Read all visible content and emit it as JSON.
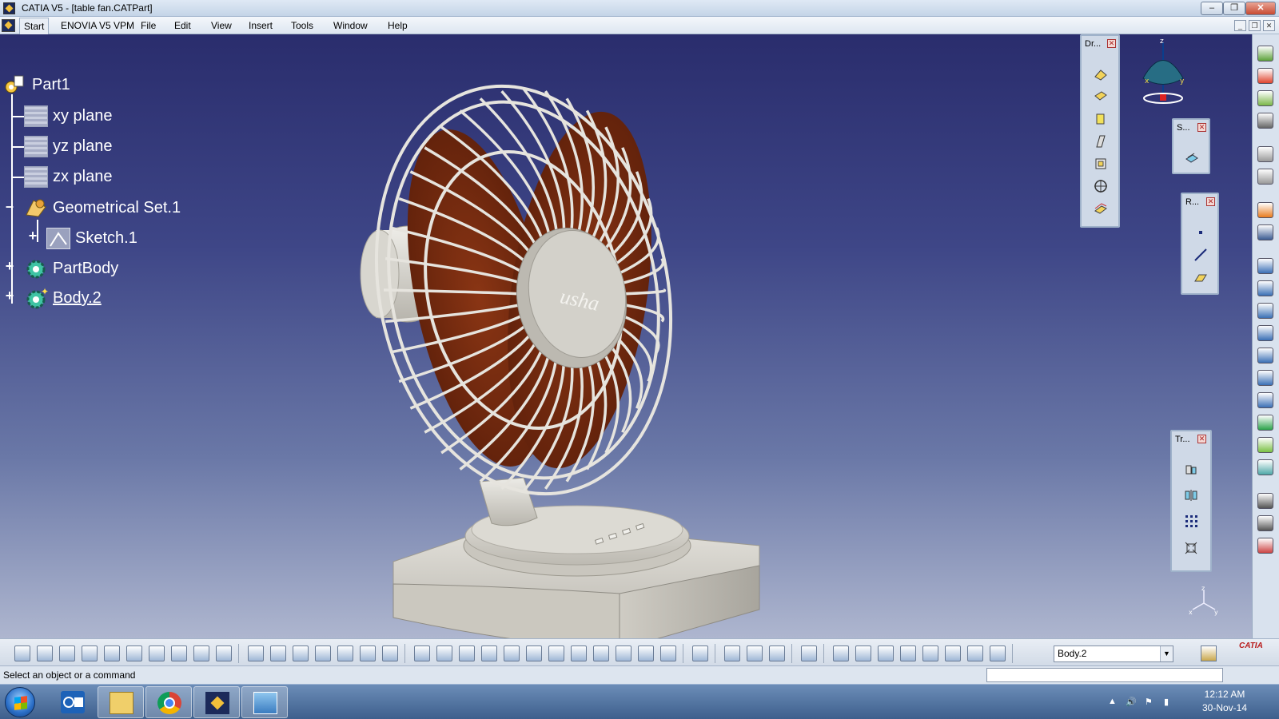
{
  "window": {
    "title": "CATIA V5 - [table fan.CATPart]"
  },
  "menubar": {
    "items": [
      "Start",
      "ENOVIA V5 VPM",
      "File",
      "Edit",
      "View",
      "Insert",
      "Tools",
      "Window",
      "Help"
    ]
  },
  "tree": {
    "root": "Part1",
    "nodes": [
      "xy plane",
      "yz plane",
      "zx plane",
      "Geometrical Set.1",
      "Sketch.1",
      "PartBody",
      "Body.2"
    ]
  },
  "toolbars": {
    "drafts": "Dr...",
    "sketch": "S...",
    "reference": "R...",
    "transform": "Tr..."
  },
  "fan": {
    "logo_text": "usha"
  },
  "compass": {
    "x": "x",
    "y": "y",
    "z": "z"
  },
  "current_body": "Body.2",
  "status": {
    "text": "Select an object or a command"
  },
  "taskbar": {
    "time": "12:12 AM",
    "date": "30-Nov-14"
  },
  "catia_logo": "CATIA",
  "colors": {
    "bg_top": "#2a2d6d",
    "bg_bottom": "#aeb6cf",
    "fan_blade": "#7a2a10",
    "fan_body": "#d8d6cf"
  }
}
